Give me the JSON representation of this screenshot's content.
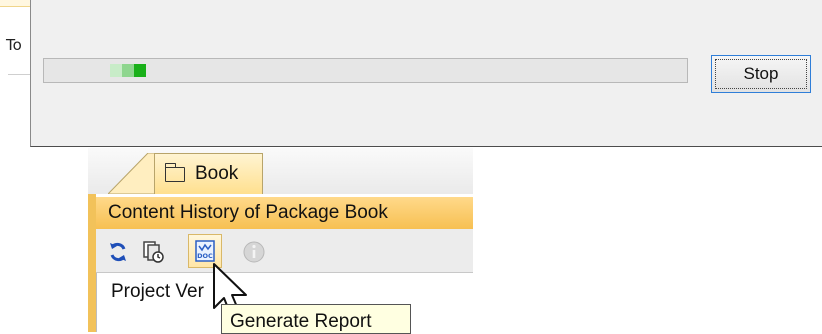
{
  "background": {
    "side_text": "To"
  },
  "progress_dialog": {
    "progress_fraction": 0.05,
    "stop_label": "Stop",
    "colors": {
      "bar_fill": "#19b019",
      "focus_border": "#2f7ed8"
    }
  },
  "tool_window": {
    "tab_label": "Book",
    "tab_icon": "folder-icon",
    "panel_title": "Content History of Package Book",
    "toolbar": {
      "buttons": [
        {
          "name": "refresh",
          "icon": "refresh-icon"
        },
        {
          "name": "compare",
          "icon": "compare-icon"
        },
        {
          "name": "generate-report",
          "icon": "report-icon",
          "icon_text": "DOC"
        },
        {
          "name": "info",
          "icon": "info-icon",
          "disabled": true
        }
      ]
    },
    "content_label": "Project Ver",
    "tooltip": "Generate Report",
    "colors": {
      "header": "#f7c052",
      "tab": "#ffe08f"
    }
  }
}
